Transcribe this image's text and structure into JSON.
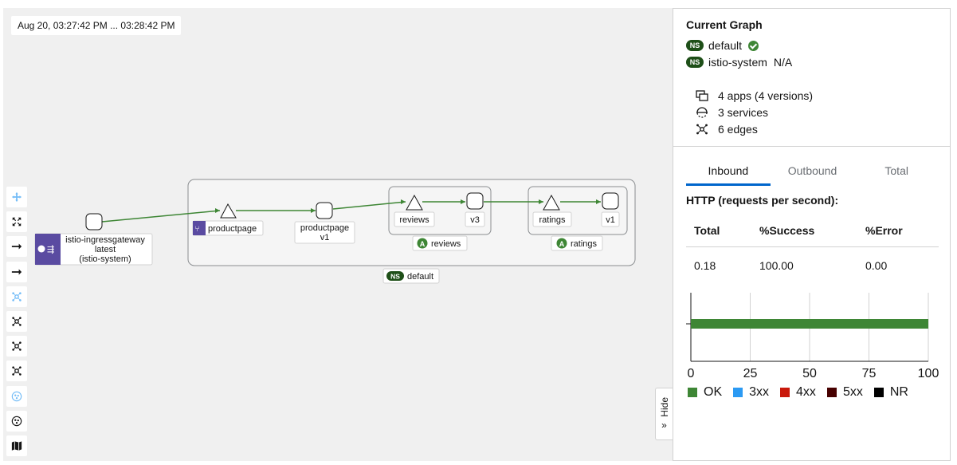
{
  "canvas": {
    "time_range": "Aug 20, 03:27:42 PM ... 03:28:42 PM",
    "hide_label": "Hide"
  },
  "toolbar": {
    "icons": [
      "move-icon",
      "fit-to-screen-icon",
      "layout-arrow-icon",
      "layout-arrow-alt-icon",
      "layout-cose-icon",
      "layout-cola-icon",
      "layout-dagre-icon",
      "layout-breadthfirst-icon",
      "namespace-layout-icon",
      "namespace-layout-alt-icon",
      "legend-map-icon"
    ]
  },
  "graph": {
    "ingress": {
      "line1": "istio-ingressgateway",
      "line2": "latest",
      "line3": "(istio-system)"
    },
    "productpage_app": "productpage",
    "productpage_version": {
      "line1": "productpage",
      "line2": "v1"
    },
    "reviews_service": "reviews",
    "reviews_version": "v3",
    "reviews_app": "reviews",
    "ratings_service": "ratings",
    "ratings_version": "v1",
    "ratings_app": "ratings",
    "namespace": "default",
    "ns_badge": "NS",
    "app_badge": "A"
  },
  "panel": {
    "title": "Current Graph",
    "namespaces": [
      {
        "badge": "NS",
        "name": "default",
        "status": "ok"
      },
      {
        "badge": "NS",
        "name": "istio-system",
        "status_text": "N/A"
      }
    ],
    "stats": [
      {
        "icon": "apps-icon",
        "text": "4 apps (4 versions)"
      },
      {
        "icon": "services-icon",
        "text": "3 services"
      },
      {
        "icon": "edges-icon",
        "text": "6 edges"
      }
    ],
    "tabs": [
      "Inbound",
      "Outbound",
      "Total"
    ],
    "active_tab": "Inbound",
    "section_title": "HTTP (requests per second):",
    "table": {
      "headers": [
        "Total",
        "%Success",
        "%Error"
      ],
      "row": [
        "0.18",
        "100.00",
        "0.00"
      ]
    }
  },
  "chart_data": {
    "type": "bar",
    "orientation": "horizontal",
    "stacked": true,
    "x": [
      0,
      25,
      50,
      75,
      100
    ],
    "xlim": [
      0,
      100
    ],
    "series": [
      {
        "name": "OK",
        "values": [
          100
        ],
        "color": "#3e8635"
      },
      {
        "name": "3xx",
        "values": [
          0
        ],
        "color": "#2b9af3"
      },
      {
        "name": "4xx",
        "values": [
          0
        ],
        "color": "#c9190b"
      },
      {
        "name": "5xx",
        "values": [
          0
        ],
        "color": "#470000"
      },
      {
        "name": "NR",
        "values": [
          0
        ],
        "color": "#000000"
      }
    ],
    "grid": true,
    "legend": "bottom"
  }
}
